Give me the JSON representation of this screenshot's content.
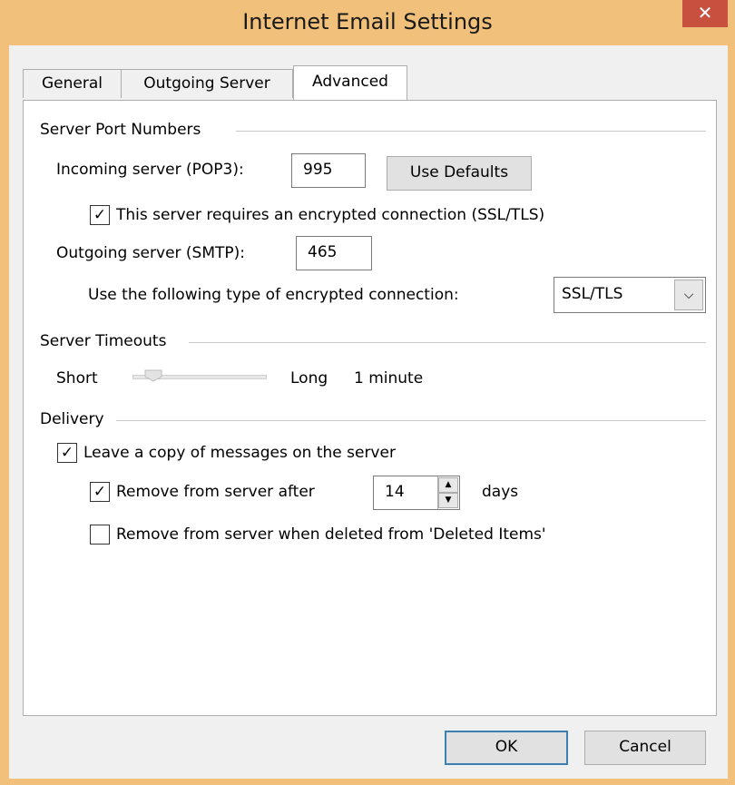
{
  "window": {
    "title": "Internet Email Settings",
    "close_glyph": "✕"
  },
  "tabs": [
    {
      "label": "General",
      "active": false
    },
    {
      "label": "Outgoing Server",
      "active": false
    },
    {
      "label": "Advanced",
      "active": true
    }
  ],
  "server_ports": {
    "group_label": "Server Port Numbers",
    "incoming_label": "Incoming server (POP3):",
    "incoming_value": "995",
    "use_defaults_label": "Use Defaults",
    "incoming_ssl_label": "This server requires an encrypted connection (SSL/TLS)",
    "incoming_ssl_checked": true,
    "outgoing_label": "Outgoing server (SMTP):",
    "outgoing_value": "465",
    "encryption_label": "Use the following type of encrypted connection:",
    "encryption_value": "SSL/TLS"
  },
  "timeouts": {
    "group_label": "Server Timeouts",
    "short_label": "Short",
    "long_label": "Long",
    "value_label": "1 minute",
    "slider_level": 0.1
  },
  "delivery": {
    "group_label": "Delivery",
    "leave_copy_label": "Leave a copy of messages on the server",
    "leave_copy_checked": true,
    "remove_after_label": "Remove from server after",
    "remove_after_checked": true,
    "remove_after_value": "14",
    "days_label": "days",
    "remove_deleted_label": "Remove from server when deleted from 'Deleted Items'",
    "remove_deleted_checked": false
  },
  "footer": {
    "ok_label": "OK",
    "cancel_label": "Cancel"
  },
  "glyphs": {
    "check": "✓",
    "dropdown": "⌵",
    "spin_up": "▲",
    "spin_down": "▼"
  },
  "colors": {
    "frame": "#f1c07a",
    "close": "#c7503f",
    "default_button_border": "#3c7fb1"
  }
}
